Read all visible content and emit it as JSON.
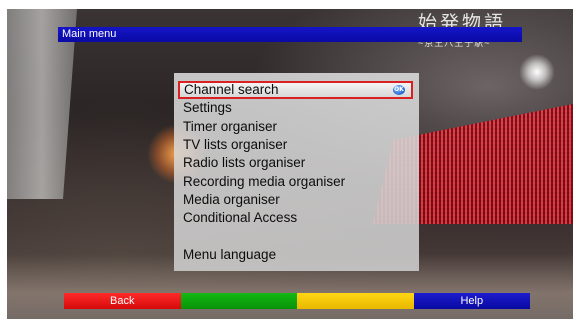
{
  "header": {
    "title": "Main menu"
  },
  "menu": {
    "items": [
      {
        "label": "Channel search",
        "selected": true,
        "badge_icon": "ok-icon",
        "badge_text": "OK"
      },
      {
        "label": "Settings",
        "selected": false
      },
      {
        "label": "Timer organiser",
        "selected": false
      },
      {
        "label": "TV lists organiser",
        "selected": false
      },
      {
        "label": "Radio lists organiser",
        "selected": false
      },
      {
        "label": "Recording media organiser",
        "selected": false
      },
      {
        "label": "Media organiser",
        "selected": false
      },
      {
        "label": "Conditional Access",
        "selected": false
      },
      {
        "label": "Menu language",
        "selected": false
      }
    ]
  },
  "color_keys": {
    "red": {
      "label": "Back",
      "color": "#e01414"
    },
    "green": {
      "label": "",
      "color": "#0ea50e"
    },
    "yellow": {
      "label": "",
      "color": "#f5c800"
    },
    "blue": {
      "label": "Help",
      "color": "#1212b8"
    }
  },
  "overlay_logo": {
    "main": "始発物語",
    "sub": "~京王八王子駅~"
  },
  "colors": {
    "selection_border": "#d92121",
    "title_bar": "#0f0fb8",
    "menu_panel": "#d6d6d6"
  }
}
